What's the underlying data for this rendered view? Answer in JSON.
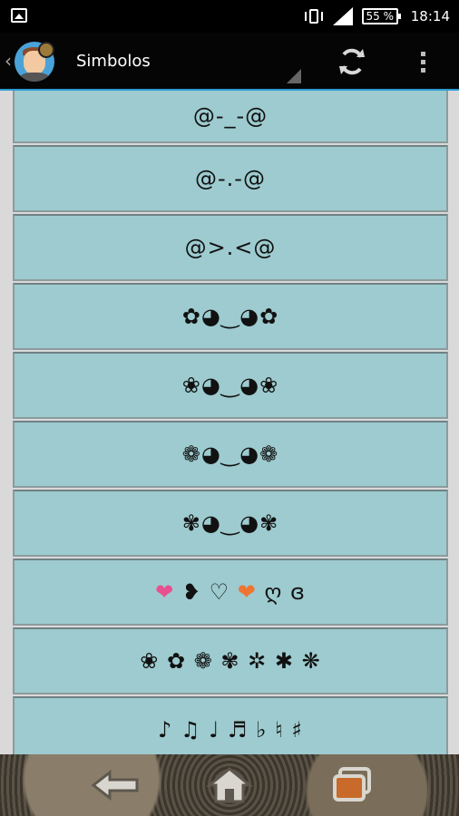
{
  "status_bar": {
    "battery": "55 %",
    "time": "18:14"
  },
  "action_bar": {
    "title": "Simbolos"
  },
  "symbols": [
    "@-_-@",
    "@-.-@",
    "@>.<@",
    "✿◕‿◕✿",
    "❀◕‿◕❀",
    "❁◕‿◕❁",
    "✾◕‿◕✾"
  ],
  "hearts_row": [
    "❤",
    "❥",
    "♡",
    "❤",
    "ღ",
    "ɞ"
  ],
  "flowers_row": "❀ ✿ ❁ ✾ ✲ ✱ ❋",
  "music_row": "♪ ♫ ♩ ♬ ♭ ♮ ♯",
  "colors": {
    "item_bg": "#9dcbcf",
    "action_bar_bg": "#050505",
    "accent_line": "#2d9bd3",
    "heart_pink": "#e9508f",
    "heart_orange": "#ef7430"
  },
  "icons": {
    "status_left": "image-notification-icon",
    "vibrate": "vibrate-icon",
    "signal": "signal-icon",
    "refresh": "refresh-icon",
    "overflow": "overflow-menu-icon",
    "back": "back-arrow-icon",
    "home": "home-icon",
    "recents": "recent-apps-icon"
  }
}
